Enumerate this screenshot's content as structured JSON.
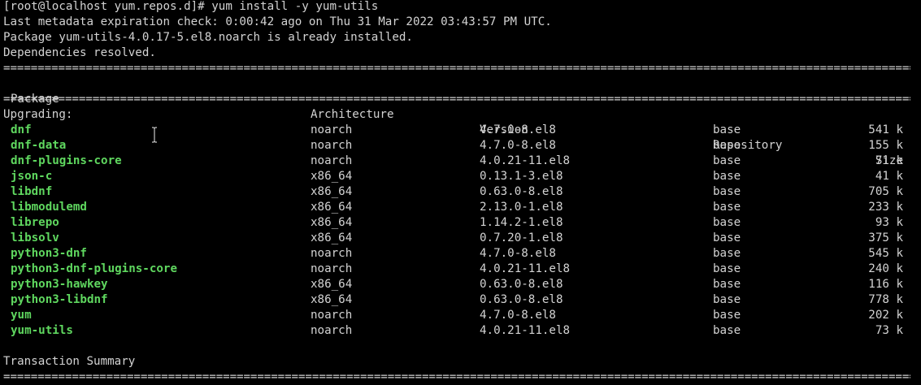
{
  "terminal": {
    "prompt_line": "[root@localhost yum.repos.d]# yum install -y yum-utils",
    "metadata_line": "Last metadata expiration check: 0:00:42 ago on Thu 31 Mar 2022 03:43:57 PM UTC.",
    "installed_line": "Package yum-utils-4.0.17-5.el8.noarch is already installed.",
    "deps_line": "Dependencies resolved.",
    "separator": "==================================================================================================================================================================",
    "headers": {
      "package": "Package",
      "architecture": "Architecture",
      "version": "Version",
      "repository": "Repository",
      "size": "Size"
    },
    "section_label": "Upgrading:",
    "packages": [
      {
        "name": "dnf",
        "arch": "noarch",
        "version": "4.7.0-8.el8",
        "repo": "base",
        "size": "541 k"
      },
      {
        "name": "dnf-data",
        "arch": "noarch",
        "version": "4.7.0-8.el8",
        "repo": "base",
        "size": "155 k"
      },
      {
        "name": "dnf-plugins-core",
        "arch": "noarch",
        "version": "4.0.21-11.el8",
        "repo": "base",
        "size": "71 k"
      },
      {
        "name": "json-c",
        "arch": "x86_64",
        "version": "0.13.1-3.el8",
        "repo": "base",
        "size": "41 k"
      },
      {
        "name": "libdnf",
        "arch": "x86_64",
        "version": "0.63.0-8.el8",
        "repo": "base",
        "size": "705 k"
      },
      {
        "name": "libmodulemd",
        "arch": "x86_64",
        "version": "2.13.0-1.el8",
        "repo": "base",
        "size": "233 k"
      },
      {
        "name": "librepo",
        "arch": "x86_64",
        "version": "1.14.2-1.el8",
        "repo": "base",
        "size": "93 k"
      },
      {
        "name": "libsolv",
        "arch": "x86_64",
        "version": "0.7.20-1.el8",
        "repo": "base",
        "size": "375 k"
      },
      {
        "name": "python3-dnf",
        "arch": "noarch",
        "version": "4.7.0-8.el8",
        "repo": "base",
        "size": "545 k"
      },
      {
        "name": "python3-dnf-plugins-core",
        "arch": "noarch",
        "version": "4.0.21-11.el8",
        "repo": "base",
        "size": "240 k"
      },
      {
        "name": "python3-hawkey",
        "arch": "x86_64",
        "version": "0.63.0-8.el8",
        "repo": "base",
        "size": "116 k"
      },
      {
        "name": "python3-libdnf",
        "arch": "x86_64",
        "version": "0.63.0-8.el8",
        "repo": "base",
        "size": "778 k"
      },
      {
        "name": "yum",
        "arch": "noarch",
        "version": "4.7.0-8.el8",
        "repo": "base",
        "size": "202 k"
      },
      {
        "name": "yum-utils",
        "arch": "noarch",
        "version": "4.0.21-11.el8",
        "repo": "base",
        "size": "73 k"
      }
    ],
    "summary_label": "Transaction Summary",
    "colors": {
      "background": "#000000",
      "text": "#d3d3d3",
      "package_name": "#5fd75f"
    },
    "mouse_cursor": "ibeam-cursor-icon"
  }
}
